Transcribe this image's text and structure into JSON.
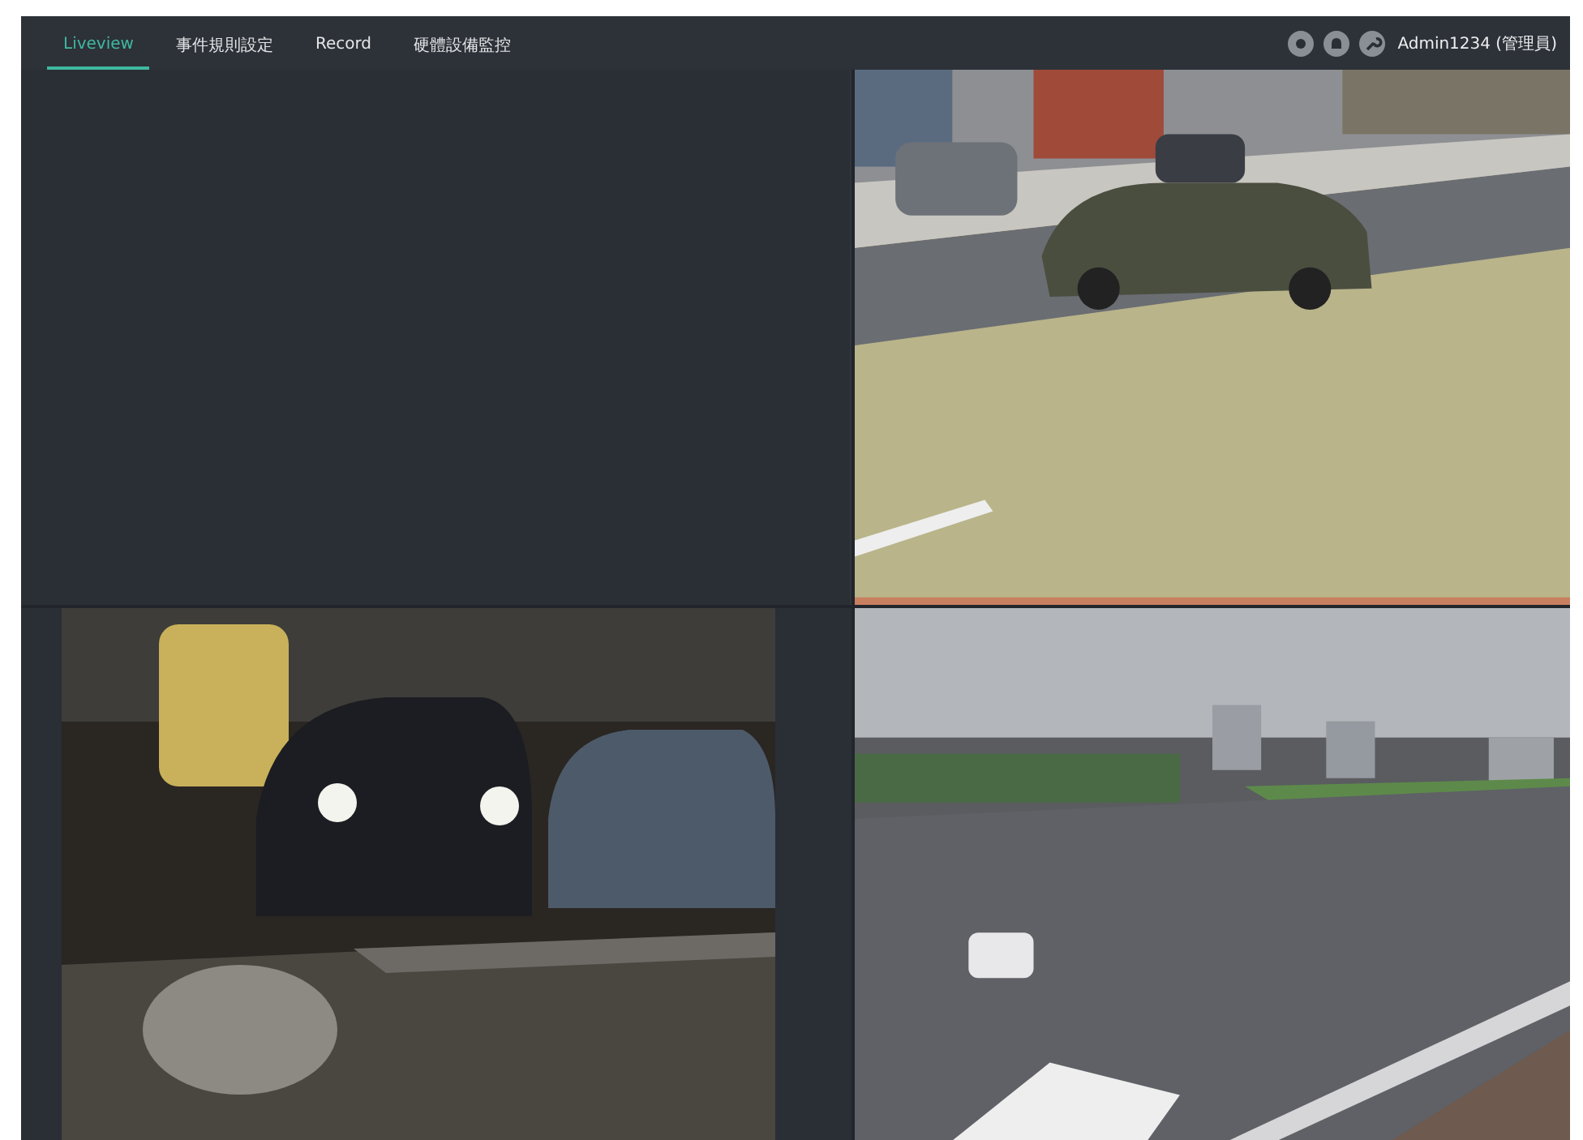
{
  "tabs": [
    {
      "label": "Liveview",
      "selected": true
    },
    {
      "label": "事件規則設定",
      "selected": false
    },
    {
      "label": "Record",
      "selected": false
    },
    {
      "label": "硬體設備監控",
      "selected": false
    }
  ],
  "user": {
    "label": "Admin1234 (管理員)"
  },
  "views": [
    {
      "kind": "empty"
    },
    {
      "kind": "picture"
    },
    {
      "kind": "picture"
    },
    {
      "kind": "picture"
    }
  ]
}
